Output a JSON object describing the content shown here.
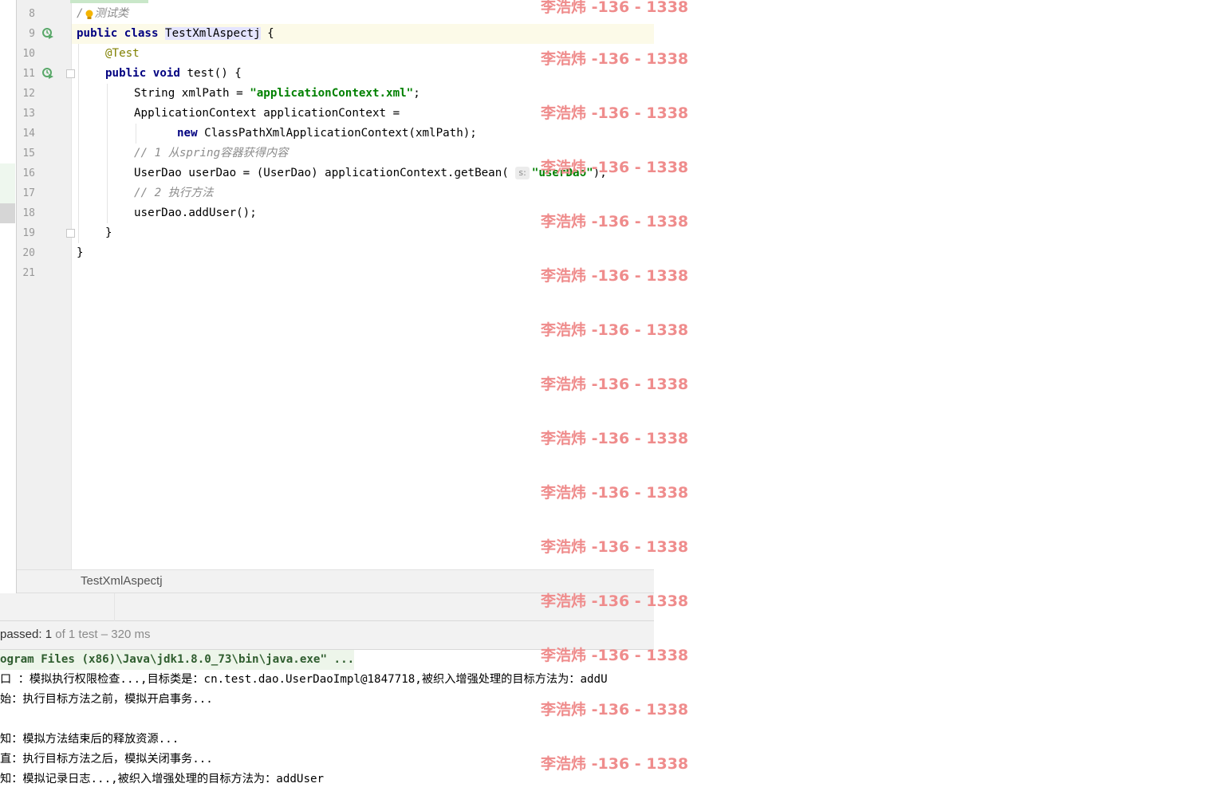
{
  "editor": {
    "lines": [
      {
        "num": "8"
      },
      {
        "num": "9"
      },
      {
        "num": "10"
      },
      {
        "num": "11"
      },
      {
        "num": "12"
      },
      {
        "num": "13"
      },
      {
        "num": "14"
      },
      {
        "num": "15"
      },
      {
        "num": "16"
      },
      {
        "num": "17"
      },
      {
        "num": "18"
      },
      {
        "num": "19"
      },
      {
        "num": "20"
      },
      {
        "num": "21"
      }
    ],
    "code": {
      "l8_slash": "/",
      "l8_comment": "测试类",
      "l9_kw": "public class",
      "l9_class": "TestXmlAspectj",
      "l9_rest": " {",
      "l10_annotation": "@Test",
      "l11_kw": "public void",
      "l11_rest": " test() {",
      "l12_a": "String xmlPath = ",
      "l12_str": "\"applicationContext.xml\"",
      "l12_b": ";",
      "l13": "ApplicationContext applicationContext =",
      "l14_kw": "new",
      "l14_rest": " ClassPathXmlApplicationContext(xmlPath);",
      "l15_comment": "// 1 从spring容器获得内容",
      "l16_a": "UserDao userDao = (UserDao) applicationContext.getBean(",
      "l16_hint": "s:",
      "l16_str": "\"userDao\"",
      "l16_b": ");",
      "l17_comment": "// 2 执行方法",
      "l18": "userDao.addUser();",
      "l19": "}",
      "l20": "}"
    }
  },
  "breadcrumb": {
    "text": "TestXmlAspectj"
  },
  "status": {
    "passed_label": "passed:",
    "passed_count": "1",
    "detail": "of 1 test – 320 ms"
  },
  "console": {
    "lines": [
      "ogram Files (x86)\\Java\\jdk1.8.0_73\\bin\\java.exe\" ...",
      "口 ：模拟执行权限检查...,目标类是：cn.test.dao.UserDaoImpl@1847718,被织入增强处理的目标方法为：addU",
      "始：执行目标方法之前，模拟开启事务...",
      "",
      "知：模拟方法结束后的释放资源...",
      "直：执行目标方法之后，模拟关闭事务...",
      "知：模拟记录日志...,被织入增强处理的目标方法为：addUser"
    ]
  },
  "watermark": {
    "text": "李浩炜 -136 - 1338"
  },
  "colors": {
    "keyword": "#000080",
    "string": "#008000",
    "comment": "#8c8c8c",
    "annotation": "#808000",
    "watermark": "#ef8c8c",
    "current_line": "#fcfae8"
  }
}
